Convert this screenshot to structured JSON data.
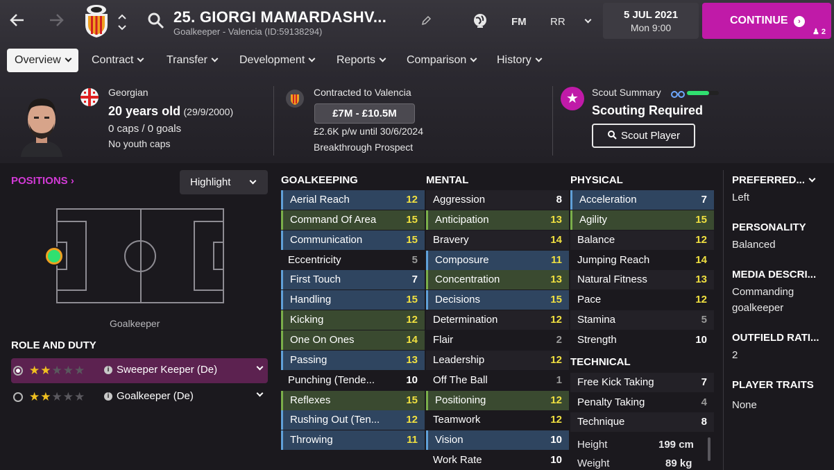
{
  "header": {
    "player_title": "25. GIORGI MAMARDASHV...",
    "subtitle": "Goalkeeper - Valencia (ID:59138294)",
    "fm_label": "FM",
    "rr_label": "RR",
    "date": "5 JUL 2021",
    "time": "Mon 9:00",
    "continue_label": "CONTINUE",
    "continue_count": "2"
  },
  "tabs": [
    {
      "label": "Overview"
    },
    {
      "label": "Contract"
    },
    {
      "label": "Transfer"
    },
    {
      "label": "Development"
    },
    {
      "label": "Reports"
    },
    {
      "label": "Comparison"
    },
    {
      "label": "History"
    }
  ],
  "profile": {
    "nationality": "Georgian",
    "age": "20 years old",
    "dob": "(29/9/2000)",
    "caps": "0 caps / 0 goals",
    "youth_caps": "No youth caps"
  },
  "contract": {
    "club_line": "Contracted to Valencia",
    "value": "£7M - £10.5M",
    "wage": "£2.6K p/w until 30/6/2024",
    "status": "Breakthrough Prospect"
  },
  "scout": {
    "title": "Scout Summary",
    "status": "Scouting Required",
    "button": "Scout Player"
  },
  "positions": {
    "header": "POSITIONS",
    "highlight": "Highlight",
    "position_name": "Goalkeeper",
    "role_header": "ROLE AND DUTY",
    "roles": [
      {
        "name": "Sweeper Keeper (De)",
        "stars": 2,
        "selected": true
      },
      {
        "name": "Goalkeeper (De)",
        "stars": 2,
        "selected": false
      }
    ]
  },
  "goalkeeping": {
    "header": "GOALKEEPING",
    "attrs": [
      {
        "name": "Aerial Reach",
        "value": "12",
        "color": "yellow",
        "hl": "blue"
      },
      {
        "name": "Command Of Area",
        "value": "15",
        "color": "yellow",
        "hl": "green"
      },
      {
        "name": "Communication",
        "value": "15",
        "color": "yellow",
        "hl": "blue"
      },
      {
        "name": "Eccentricity",
        "value": "5",
        "color": "grey",
        "hl": ""
      },
      {
        "name": "First Touch",
        "value": "7",
        "color": "white",
        "hl": "blue"
      },
      {
        "name": "Handling",
        "value": "15",
        "color": "yellow",
        "hl": "blue"
      },
      {
        "name": "Kicking",
        "value": "12",
        "color": "yellow",
        "hl": "green"
      },
      {
        "name": "One On Ones",
        "value": "14",
        "color": "yellow",
        "hl": "green"
      },
      {
        "name": "Passing",
        "value": "13",
        "color": "yellow",
        "hl": "blue"
      },
      {
        "name": "Punching (Tende...",
        "value": "10",
        "color": "white",
        "hl": ""
      },
      {
        "name": "Reflexes",
        "value": "15",
        "color": "yellow",
        "hl": "green"
      },
      {
        "name": "Rushing Out (Ten...",
        "value": "12",
        "color": "yellow",
        "hl": "blue"
      },
      {
        "name": "Throwing",
        "value": "11",
        "color": "yellow",
        "hl": "blue"
      }
    ]
  },
  "mental": {
    "header": "MENTAL",
    "attrs": [
      {
        "name": "Aggression",
        "value": "8",
        "color": "white",
        "hl": ""
      },
      {
        "name": "Anticipation",
        "value": "13",
        "color": "yellow",
        "hl": "green"
      },
      {
        "name": "Bravery",
        "value": "14",
        "color": "yellow",
        "hl": ""
      },
      {
        "name": "Composure",
        "value": "11",
        "color": "yellow",
        "hl": "blue"
      },
      {
        "name": "Concentration",
        "value": "13",
        "color": "yellow",
        "hl": "green"
      },
      {
        "name": "Decisions",
        "value": "15",
        "color": "yellow",
        "hl": "blue"
      },
      {
        "name": "Determination",
        "value": "12",
        "color": "yellow",
        "hl": ""
      },
      {
        "name": "Flair",
        "value": "2",
        "color": "grey",
        "hl": ""
      },
      {
        "name": "Leadership",
        "value": "12",
        "color": "yellow",
        "hl": ""
      },
      {
        "name": "Off The Ball",
        "value": "1",
        "color": "grey",
        "hl": ""
      },
      {
        "name": "Positioning",
        "value": "12",
        "color": "yellow",
        "hl": "green"
      },
      {
        "name": "Teamwork",
        "value": "12",
        "color": "yellow",
        "hl": ""
      },
      {
        "name": "Vision",
        "value": "10",
        "color": "white",
        "hl": "blue"
      },
      {
        "name": "Work Rate",
        "value": "10",
        "color": "white",
        "hl": ""
      }
    ]
  },
  "physical": {
    "header": "PHYSICAL",
    "attrs": [
      {
        "name": "Acceleration",
        "value": "7",
        "color": "white",
        "hl": "blue"
      },
      {
        "name": "Agility",
        "value": "15",
        "color": "yellow",
        "hl": "green"
      },
      {
        "name": "Balance",
        "value": "12",
        "color": "yellow",
        "hl": ""
      },
      {
        "name": "Jumping Reach",
        "value": "14",
        "color": "yellow",
        "hl": ""
      },
      {
        "name": "Natural Fitness",
        "value": "13",
        "color": "yellow",
        "hl": ""
      },
      {
        "name": "Pace",
        "value": "12",
        "color": "yellow",
        "hl": ""
      },
      {
        "name": "Stamina",
        "value": "5",
        "color": "grey",
        "hl": ""
      },
      {
        "name": "Strength",
        "value": "10",
        "color": "white",
        "hl": ""
      }
    ]
  },
  "technical": {
    "header": "TECHNICAL",
    "attrs": [
      {
        "name": "Free Kick Taking",
        "value": "7",
        "color": "white",
        "hl": ""
      },
      {
        "name": "Penalty Taking",
        "value": "4",
        "color": "grey",
        "hl": ""
      },
      {
        "name": "Technique",
        "value": "8",
        "color": "white",
        "hl": ""
      }
    ]
  },
  "bio": [
    {
      "label": "Height",
      "value": "199 cm"
    },
    {
      "label": "Weight",
      "value": "89 kg"
    }
  ],
  "side": {
    "foot_h": "PREFERRED...",
    "foot_v": "Left",
    "pers_h": "PERSONALITY",
    "pers_v": "Balanced",
    "media_h": "MEDIA DESCRI...",
    "media_v1": "Commanding",
    "media_v2": "goalkeeper",
    "out_h": "OUTFIELD RATI...",
    "out_v": "2",
    "traits_h": "PLAYER TRAITS",
    "traits_v": "None"
  },
  "colors": {
    "accent": "#c01aa8",
    "yellow": "#f0e040",
    "row_blue": "#2f4560",
    "row_green": "#3a4a30"
  }
}
